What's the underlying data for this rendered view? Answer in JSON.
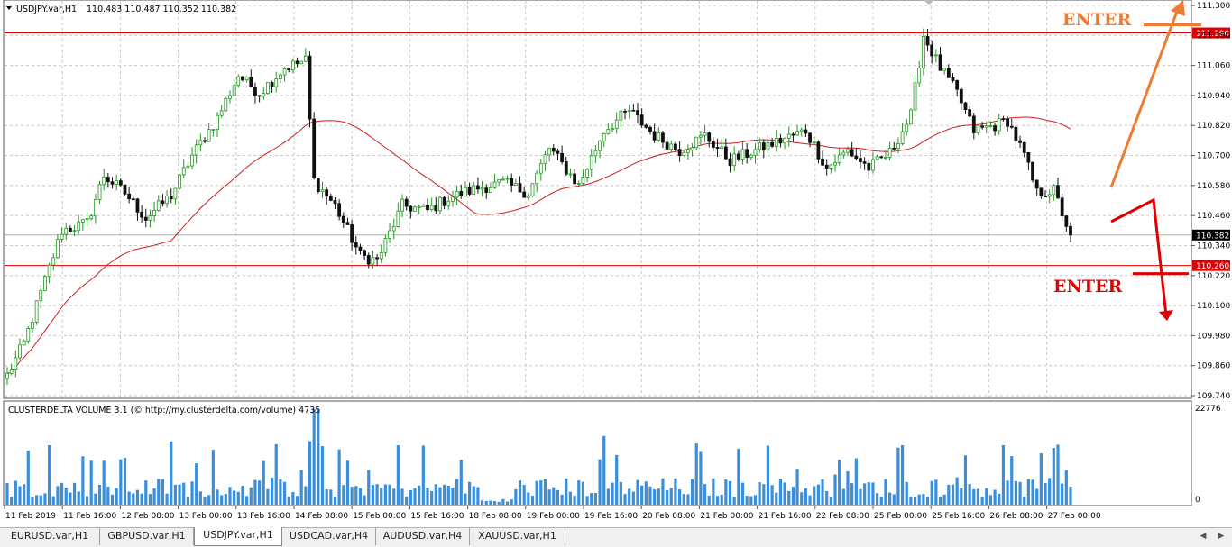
{
  "chart": {
    "title": "USDJPY.var,H1",
    "ohlc_text": "110.483 110.487 110.352 110.382",
    "price_axis": [
      {
        "label": "111.300",
        "value": 111.3
      },
      {
        "label": "111.180",
        "value": 111.18
      },
      {
        "label": "111.060",
        "value": 111.06
      },
      {
        "label": "110.940",
        "value": 110.94
      },
      {
        "label": "110.820",
        "value": 110.82
      },
      {
        "label": "110.700",
        "value": 110.7
      },
      {
        "label": "110.580",
        "value": 110.58
      },
      {
        "label": "110.460",
        "value": 110.46
      },
      {
        "label": "110.340",
        "value": 110.34
      },
      {
        "label": "110.220",
        "value": 110.22
      },
      {
        "label": "110.100",
        "value": 110.1
      },
      {
        "label": "109.980",
        "value": 109.98
      },
      {
        "label": "109.860",
        "value": 109.86
      },
      {
        "label": "109.740",
        "value": 109.74
      }
    ],
    "levels": [
      {
        "label": "111.190",
        "value": 111.19,
        "color": "#e00000"
      },
      {
        "label": "110.260",
        "value": 110.26,
        "color": "#e00000"
      }
    ],
    "current_price": {
      "label": "110.382",
      "value": 110.382
    },
    "time_labels": [
      "11 Feb 2019",
      "11 Feb 16:00",
      "12 Feb 08:00",
      "13 Feb 00:00",
      "13 Feb 16:00",
      "14 Feb 08:00",
      "15 Feb 00:00",
      "15 Feb 16:00",
      "18 Feb 08:00",
      "19 Feb 00:00",
      "19 Feb 16:00",
      "20 Feb 08:00",
      "21 Feb 00:00",
      "21 Feb 16:00",
      "22 Feb 08:00",
      "25 Feb 00:00",
      "25 Feb 16:00",
      "26 Feb 08:00",
      "27 Feb 00:00"
    ],
    "annotations": [
      {
        "text": "ENTER",
        "color": "#f07a30"
      },
      {
        "text": "ENTER",
        "color": "#e00000"
      }
    ],
    "colors": {
      "bull": "#1f9a1f",
      "bear": "#111111",
      "ma": "#cc1f1f",
      "grid": "#c8c8c8",
      "arrow_up": "#f07a30",
      "arrow_down": "#e00000"
    }
  },
  "indicator": {
    "title": "CLUSTERDELTA VOLUME 3.1 (© http://my.clusterdelta.com/volume) 4735",
    "scale_max": "22776",
    "scale_min": "0",
    "bar_color": "#3a8fdc"
  },
  "chart_data": {
    "type": "candlestick",
    "anchors": [
      {
        "t": 0,
        "p": 109.82
      },
      {
        "t": 4,
        "p": 109.95
      },
      {
        "t": 8,
        "p": 110.15
      },
      {
        "t": 13,
        "p": 110.4
      },
      {
        "t": 19,
        "p": 110.43
      },
      {
        "t": 23,
        "p": 110.62
      },
      {
        "t": 28,
        "p": 110.55
      },
      {
        "t": 33,
        "p": 110.45
      },
      {
        "t": 39,
        "p": 110.54
      },
      {
        "t": 44,
        "p": 110.7
      },
      {
        "t": 50,
        "p": 110.85
      },
      {
        "t": 55,
        "p": 111.02
      },
      {
        "t": 60,
        "p": 110.95
      },
      {
        "t": 66,
        "p": 111.05
      },
      {
        "t": 71,
        "p": 111.08
      },
      {
        "t": 73,
        "p": 110.6
      },
      {
        "t": 78,
        "p": 110.5
      },
      {
        "t": 84,
        "p": 110.3
      },
      {
        "t": 88,
        "p": 110.28
      },
      {
        "t": 94,
        "p": 110.5
      },
      {
        "t": 100,
        "p": 110.48
      },
      {
        "t": 105,
        "p": 110.53
      },
      {
        "t": 112,
        "p": 110.57
      },
      {
        "t": 118,
        "p": 110.59
      },
      {
        "t": 124,
        "p": 110.55
      },
      {
        "t": 129,
        "p": 110.73
      },
      {
        "t": 136,
        "p": 110.58
      },
      {
        "t": 142,
        "p": 110.8
      },
      {
        "t": 148,
        "p": 110.88
      },
      {
        "t": 154,
        "p": 110.78
      },
      {
        "t": 160,
        "p": 110.72
      },
      {
        "t": 166,
        "p": 110.78
      },
      {
        "t": 172,
        "p": 110.68
      },
      {
        "t": 178,
        "p": 110.72
      },
      {
        "t": 184,
        "p": 110.76
      },
      {
        "t": 190,
        "p": 110.8
      },
      {
        "t": 195,
        "p": 110.65
      },
      {
        "t": 200,
        "p": 110.72
      },
      {
        "t": 205,
        "p": 110.65
      },
      {
        "t": 210,
        "p": 110.71
      },
      {
        "t": 215,
        "p": 110.86
      },
      {
        "t": 218,
        "p": 111.18
      },
      {
        "t": 222,
        "p": 111.05
      },
      {
        "t": 226,
        "p": 110.95
      },
      {
        "t": 230,
        "p": 110.8
      },
      {
        "t": 235,
        "p": 110.82
      },
      {
        "t": 238,
        "p": 110.84
      },
      {
        "t": 242,
        "p": 110.7
      },
      {
        "t": 245,
        "p": 110.55
      },
      {
        "t": 249,
        "p": 110.56
      },
      {
        "t": 253,
        "p": 110.38
      }
    ],
    "ma_period": 40,
    "volume": {
      "max": 22776,
      "min": 0
    }
  },
  "tabs": [
    {
      "label": "EURUSD.var,H1",
      "active": false
    },
    {
      "label": "GBPUSD.var,H1",
      "active": false
    },
    {
      "label": "USDJPY.var,H1",
      "active": true
    },
    {
      "label": "USDCAD.var,H4",
      "active": false
    },
    {
      "label": "AUDUSD.var,H4",
      "active": false
    },
    {
      "label": "XAUUSD.var,H1",
      "active": false
    }
  ]
}
